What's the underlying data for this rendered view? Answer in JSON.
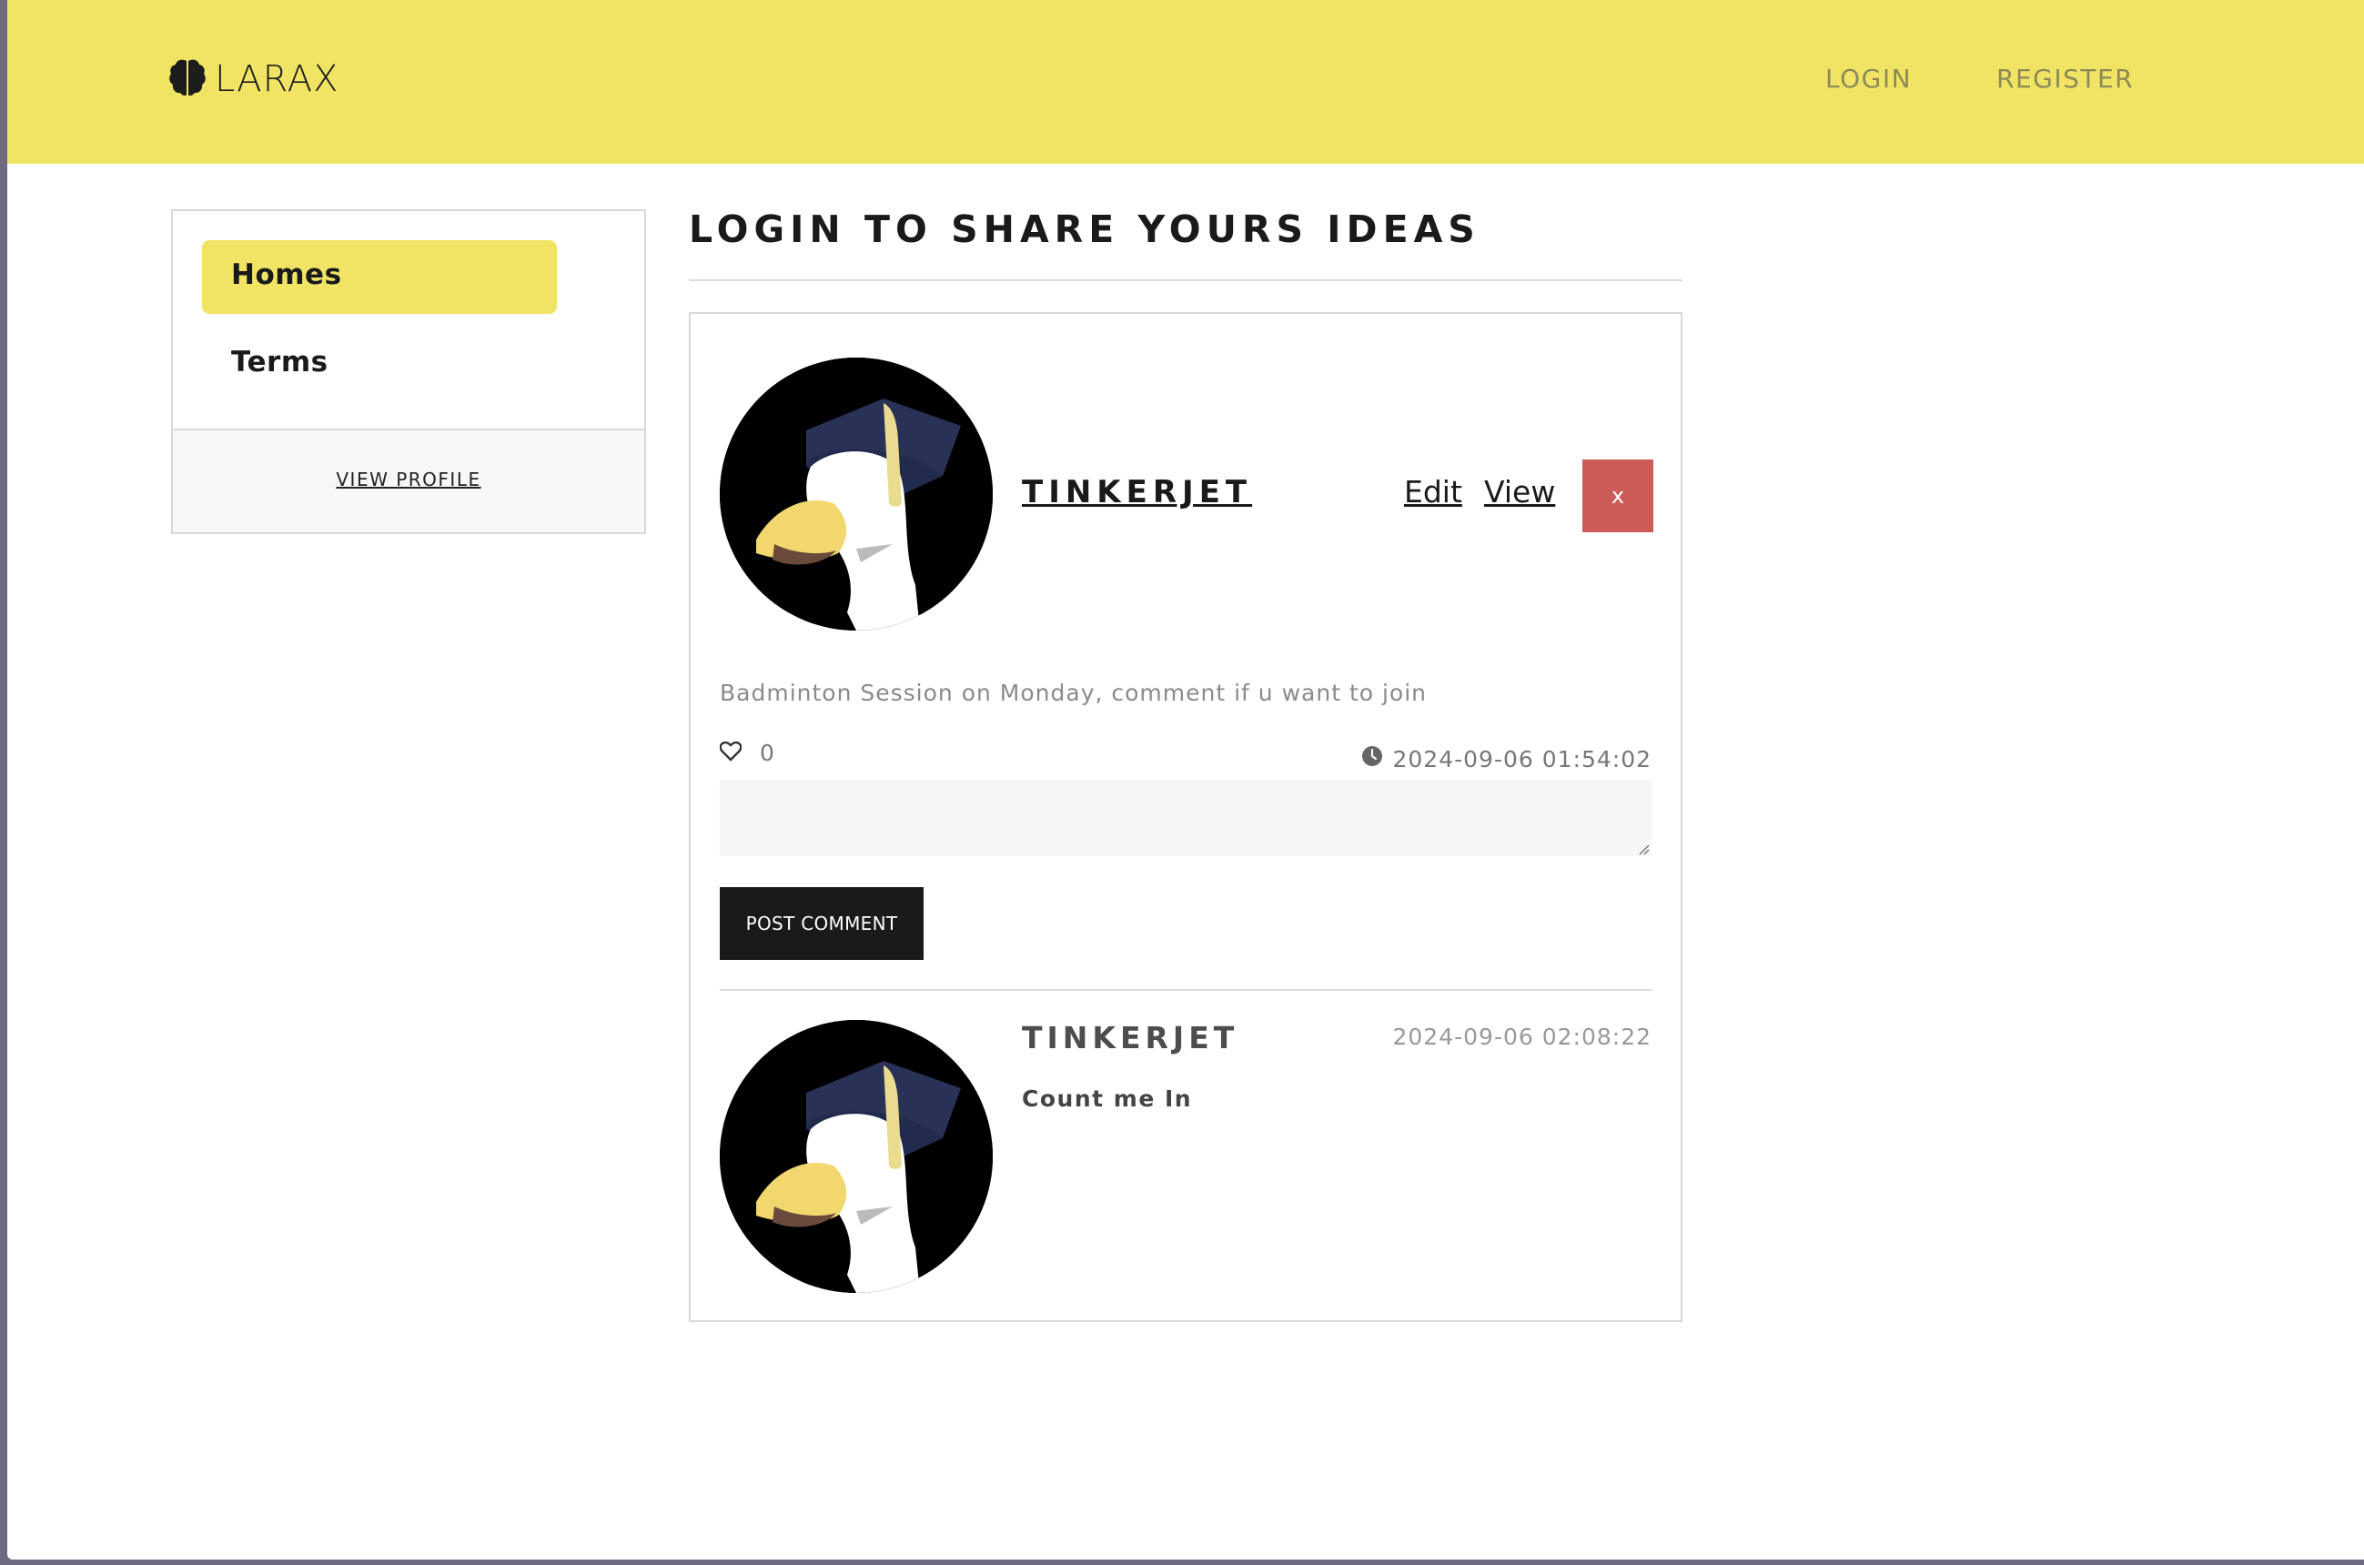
{
  "header": {
    "brand": "LARAX",
    "nav": {
      "login": "LOGIN",
      "register": "REGISTER"
    }
  },
  "sidebar": {
    "items": [
      {
        "label": "Homes",
        "active": true
      },
      {
        "label": "Terms",
        "active": false
      }
    ],
    "footer_link": "VIEW PROFILE"
  },
  "main": {
    "title": "LOGIN TO SHARE YOURS IDEAS"
  },
  "post": {
    "author": "TINKERJET",
    "actions": {
      "edit": "Edit",
      "view": "View",
      "delete": "x"
    },
    "text": "Badminton Session on Monday, comment if u want to join",
    "likes": "0",
    "timestamp": "2024-09-06 01:54:02",
    "comment_input": {
      "value": "",
      "placeholder": ""
    },
    "post_comment_label": "POST COMMENT"
  },
  "comments": [
    {
      "author": "TINKERJET",
      "timestamp": "2024-09-06 02:08:22",
      "text": "Count me In"
    }
  ],
  "colors": {
    "accent": "#f1e464",
    "danger": "#cd5c59",
    "dark": "#1a1a1a"
  },
  "icons": {
    "brand": "brain-icon",
    "like": "heart-icon",
    "time": "clock-icon"
  }
}
